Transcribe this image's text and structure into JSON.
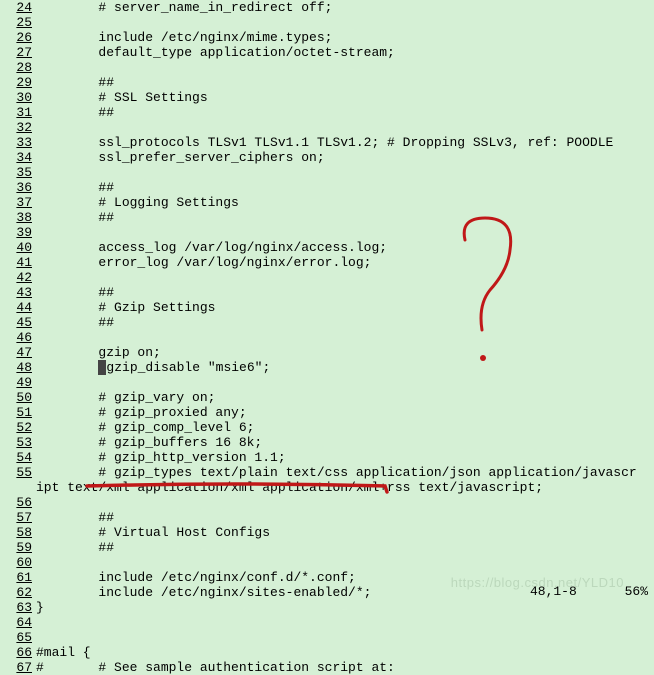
{
  "lines": [
    {
      "n": "24",
      "t": "        # server_name_in_redirect off;"
    },
    {
      "n": "25",
      "t": ""
    },
    {
      "n": "26",
      "t": "        include /etc/nginx/mime.types;"
    },
    {
      "n": "27",
      "t": "        default_type application/octet-stream;"
    },
    {
      "n": "28",
      "t": ""
    },
    {
      "n": "29",
      "t": "        ##"
    },
    {
      "n": "30",
      "t": "        # SSL Settings"
    },
    {
      "n": "31",
      "t": "        ##"
    },
    {
      "n": "32",
      "t": ""
    },
    {
      "n": "33",
      "t": "        ssl_protocols TLSv1 TLSv1.1 TLSv1.2; # Dropping SSLv3, ref: POODLE"
    },
    {
      "n": "34",
      "t": "        ssl_prefer_server_ciphers on;"
    },
    {
      "n": "35",
      "t": ""
    },
    {
      "n": "36",
      "t": "        ##"
    },
    {
      "n": "37",
      "t": "        # Logging Settings"
    },
    {
      "n": "38",
      "t": "        ##"
    },
    {
      "n": "39",
      "t": ""
    },
    {
      "n": "40",
      "t": "        access_log /var/log/nginx/access.log;"
    },
    {
      "n": "41",
      "t": "        error_log /var/log/nginx/error.log;"
    },
    {
      "n": "42",
      "t": ""
    },
    {
      "n": "43",
      "t": "        ##"
    },
    {
      "n": "44",
      "t": "        # Gzip Settings"
    },
    {
      "n": "45",
      "t": "        ##"
    },
    {
      "n": "46",
      "t": ""
    },
    {
      "n": "47",
      "t": "        gzip on;"
    },
    {
      "n": "48",
      "t": "        ",
      "cursor": true,
      "after": "gzip_disable \"msie6\";"
    },
    {
      "n": "49",
      "t": ""
    },
    {
      "n": "50",
      "t": "        # gzip_vary on;"
    },
    {
      "n": "51",
      "t": "        # gzip_proxied any;"
    },
    {
      "n": "52",
      "t": "        # gzip_comp_level 6;"
    },
    {
      "n": "53",
      "t": "        # gzip_buffers 16 8k;"
    },
    {
      "n": "54",
      "t": "        # gzip_http_version 1.1;"
    },
    {
      "n": "55",
      "t": "        # gzip_types text/plain text/css application/json application/javascr"
    },
    {
      "n": "",
      "t": "ipt text/xml application/xml application/xml+rss text/javascript;"
    },
    {
      "n": "56",
      "t": ""
    },
    {
      "n": "57",
      "t": "        ##"
    },
    {
      "n": "58",
      "t": "        # Virtual Host Configs"
    },
    {
      "n": "59",
      "t": "        ##"
    },
    {
      "n": "60",
      "t": ""
    },
    {
      "n": "61",
      "t": "        include /etc/nginx/conf.d/*.conf;"
    },
    {
      "n": "62",
      "t": "        include /etc/nginx/sites-enabled/*;"
    },
    {
      "n": "63",
      "t": "}"
    },
    {
      "n": "64",
      "t": ""
    },
    {
      "n": "65",
      "t": ""
    },
    {
      "n": "66",
      "t": "#mail {"
    },
    {
      "n": "67",
      "t": "#       # See sample authentication script at:"
    }
  ],
  "status": {
    "pos": "48,1-8",
    "pct": "56%"
  },
  "watermark": "https://blog.csdn.net/YLD10"
}
